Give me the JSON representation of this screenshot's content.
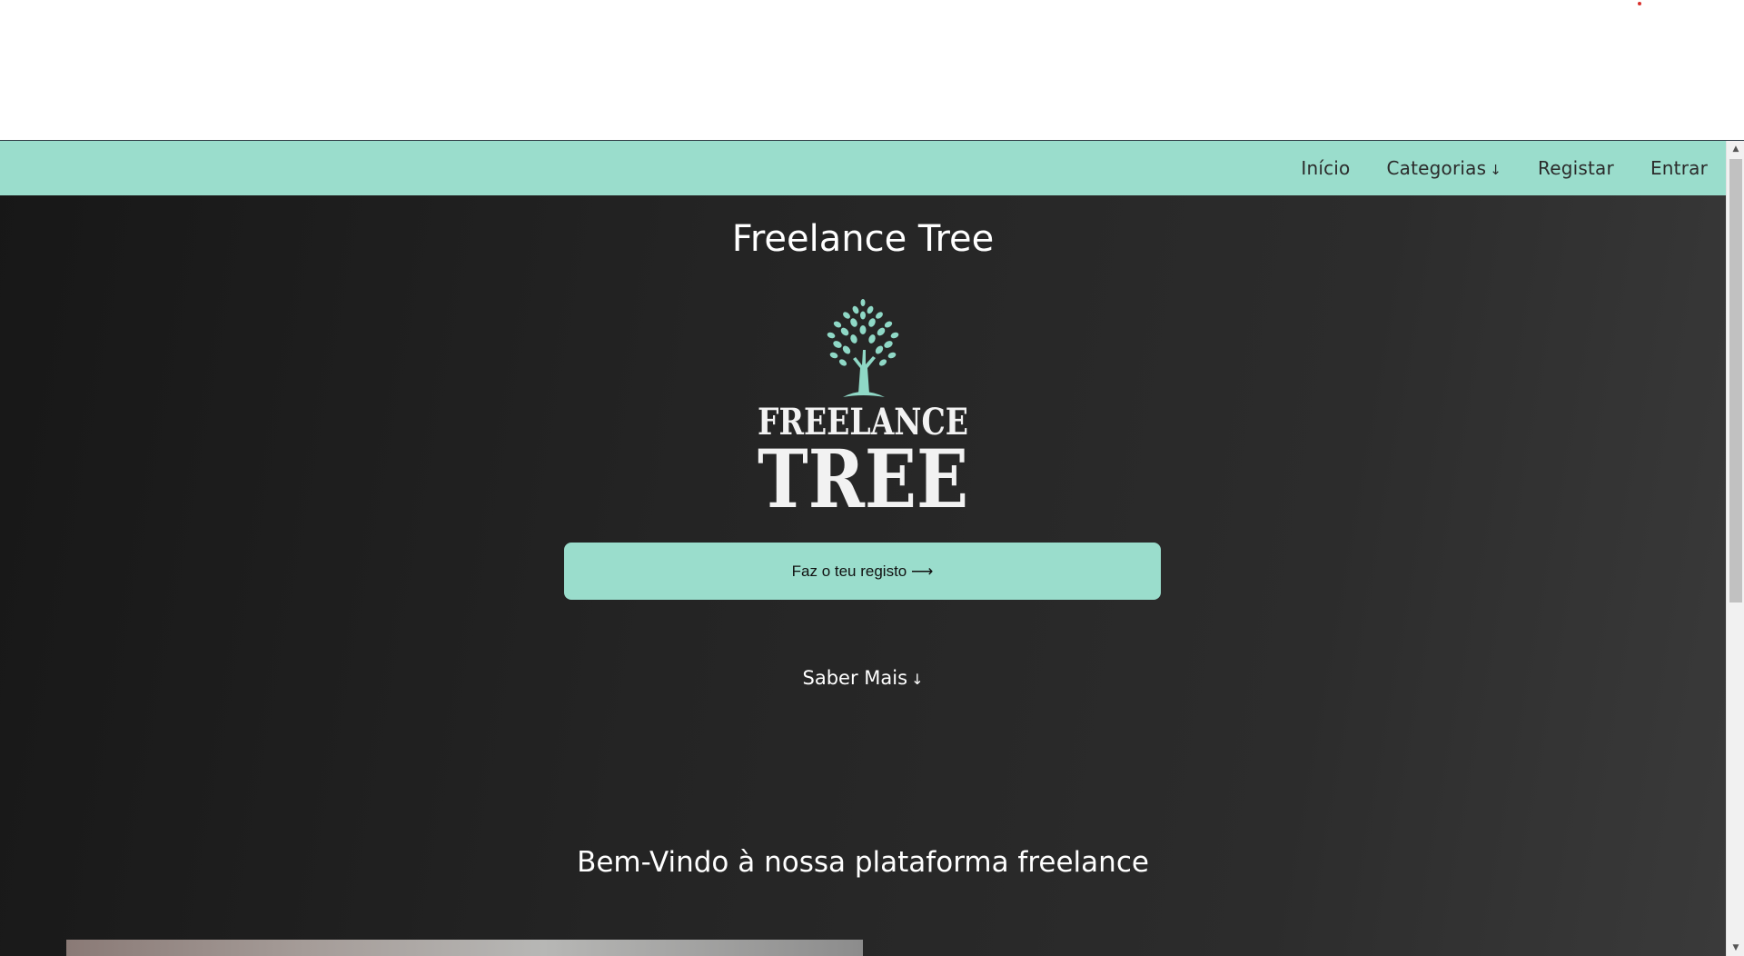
{
  "nav": {
    "items": [
      {
        "label": "Início"
      },
      {
        "label": "Categorias",
        "arrow": "↓"
      },
      {
        "label": "Registar"
      },
      {
        "label": "Entrar"
      }
    ]
  },
  "hero": {
    "title": "Freelance Tree",
    "logo": {
      "line1": "FREELANCE",
      "line2": "TREE",
      "icon": "tree-icon"
    },
    "cta_label": "Faz o teu registo ⟶",
    "learn_more_label": "Saber Mais",
    "learn_more_arrow": "↓"
  },
  "welcome": {
    "heading": "Bem-Vindo à nossa plataforma freelance"
  },
  "scrollbar": {
    "up": "▲",
    "down": "▼"
  },
  "colors": {
    "accent": "#9addcc",
    "background": "#232323",
    "text": "#ffffff"
  }
}
